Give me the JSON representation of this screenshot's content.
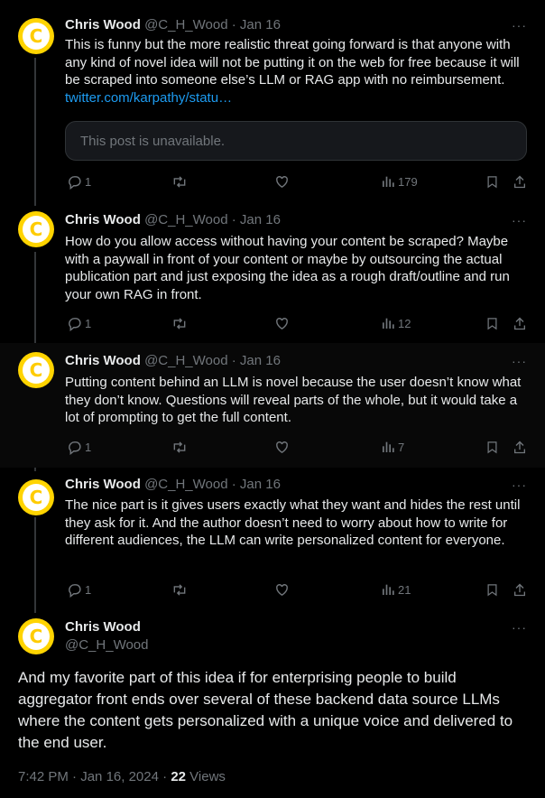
{
  "tweets": [
    {
      "name": "Chris Wood",
      "handle": "@C_H_Wood",
      "date": "Jan 16",
      "text": "This is funny but the more realistic threat going forward is that anyone with any kind of novel idea will not be putting it on the web for free because it will be scraped into someone else’s LLM or RAG app with no reimbursement.",
      "link": "twitter.com/karpathy/statu…",
      "quote": "This post is unavailable.",
      "replies": "1",
      "views": "179"
    },
    {
      "name": "Chris Wood",
      "handle": "@C_H_Wood",
      "date": "Jan 16",
      "text": "How do you allow access without having your content be scraped? Maybe with a paywall in front of your content or maybe by outsourcing the actual publication part and just exposing the idea as a rough draft/outline and run your own RAG in front.",
      "replies": "1",
      "views": "12"
    },
    {
      "name": "Chris Wood",
      "handle": "@C_H_Wood",
      "date": "Jan 16",
      "text": "Putting content behind an LLM is novel because the user doesn’t know what they don’t know. Questions will reveal parts of the whole, but it would take a lot of prompting to get the full content.",
      "replies": "1",
      "views": "7"
    },
    {
      "name": "Chris Wood",
      "handle": "@C_H_Wood",
      "date": "Jan 16",
      "text": "The nice part is it gives users exactly what they want and hides the rest until they ask for it. And the author doesn’t need to worry about how to write for different audiences, the LLM can write personalized content for everyone.",
      "replies": "1",
      "views": "21"
    }
  ],
  "main": {
    "name": "Chris Wood",
    "handle": "@C_H_Wood",
    "text": "And my favorite part of this idea if for enterprising people to build aggregator front ends over several of these backend data source LLMs where the content gets personalized with a unique voice and delivered to the end user.",
    "time": "7:42 PM",
    "date": "Jan 16, 2024",
    "views_count": "22",
    "views_label": "Views"
  },
  "common": {
    "separator": "·",
    "more": "···",
    "avatar_letter": "C"
  }
}
